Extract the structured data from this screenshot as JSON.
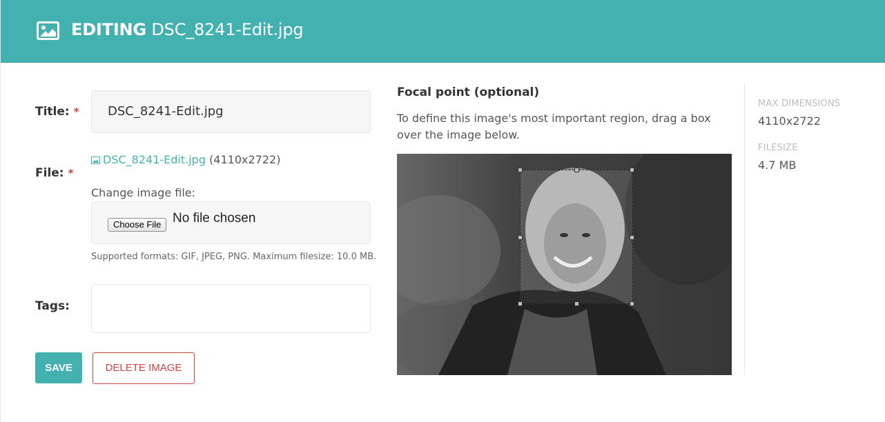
{
  "header": {
    "prefix": "EDITING",
    "filename": "DSC_8241-Edit.jpg",
    "icon": "image-icon"
  },
  "form": {
    "title_label": "Title:",
    "title_value": "DSC_8241-Edit.jpg",
    "required_marker": "*",
    "file_label": "File:",
    "file_link": "DSC_8241-Edit.jpg",
    "file_dims": "(4110x2722)",
    "change_label": "Change image file:",
    "choose_button": "Choose File",
    "no_file": "No file chosen",
    "help_text": "Supported formats: GIF, JPEG, PNG. Maximum filesize: 10.0 MB.",
    "tags_label": "Tags:",
    "tags_value": ""
  },
  "actions": {
    "save": "SAVE",
    "delete": "DELETE IMAGE"
  },
  "focal": {
    "title": "Focal point (optional)",
    "description": "To define this image's most important region, drag a box over the image below."
  },
  "meta": {
    "dimensions_label": "MAX DIMENSIONS",
    "dimensions_value": "4110x2722",
    "filesize_label": "FILESIZE",
    "filesize_value": "4.7 MB"
  },
  "colors": {
    "accent": "#43b1b0",
    "danger": "#cd4444"
  }
}
